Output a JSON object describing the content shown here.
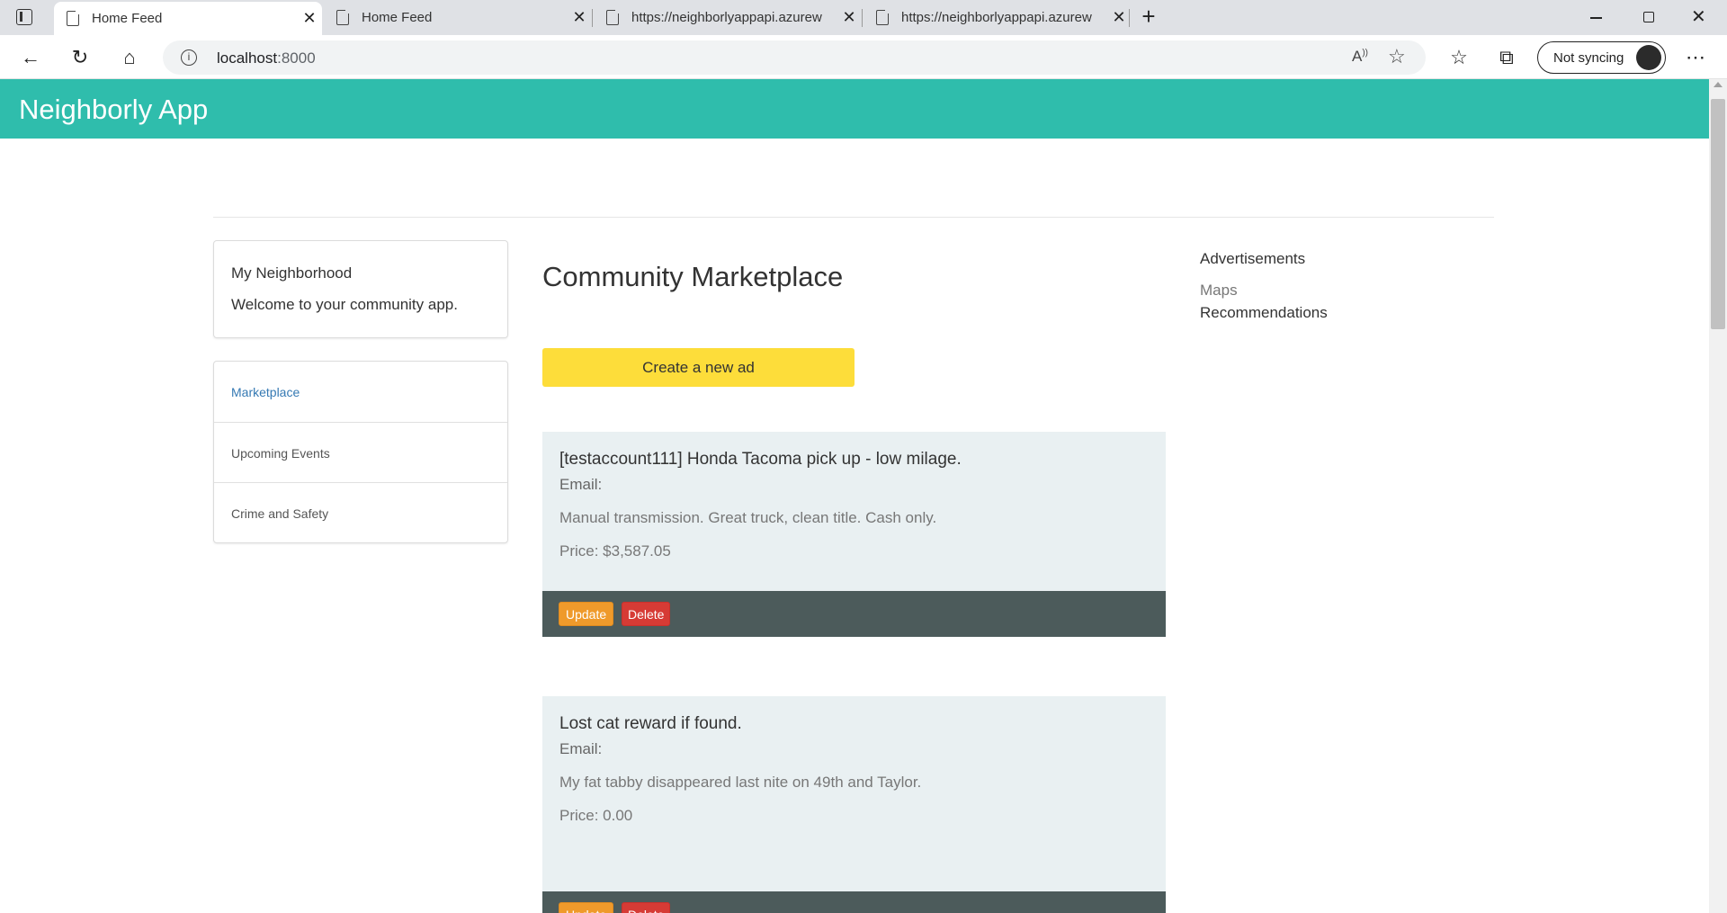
{
  "browser": {
    "tabs": [
      {
        "label": "Home Feed",
        "active": true
      },
      {
        "label": "Home Feed",
        "active": false
      },
      {
        "label": "https://neighborlyappapi.azurew",
        "active": false
      },
      {
        "label": "https://neighborlyappapi.azurew",
        "active": false
      }
    ],
    "address": {
      "host": "localhost",
      "port": ":8000"
    },
    "sync_label": "Not syncing"
  },
  "app": {
    "title": "Neighborly App",
    "sidebar": {
      "panel_title": "My Neighborhood",
      "welcome": "Welcome to your community app.",
      "nav": [
        {
          "label": "Marketplace",
          "active": true
        },
        {
          "label": "Upcoming Events",
          "active": false
        },
        {
          "label": "Crime and Safety",
          "active": false
        }
      ]
    },
    "main": {
      "title": "Community Marketplace",
      "create_label": "Create a new ad",
      "ads": [
        {
          "title": "[testaccount111] Honda Tacoma pick up - low milage.",
          "email": "Email:",
          "description": "Manual transmission. Great truck, clean title. Cash only.",
          "price": "Price: $3,587.05",
          "update_label": "Update",
          "delete_label": "Delete"
        },
        {
          "title": "Lost cat reward if found.",
          "email": "Email:",
          "description": "My fat tabby disappeared last nite on 49th and Taylor.",
          "price": "Price: 0.00",
          "update_label": "Update",
          "delete_label": "Delete"
        }
      ]
    },
    "right": {
      "heading": "Advertisements",
      "maps": "Maps",
      "recommendations": "Recommendations"
    }
  },
  "colors": {
    "appbar": "#2fbdac",
    "create_button": "#fddd3a",
    "update_button": "#ef9a2b",
    "delete_button": "#d63b35",
    "card_bg": "#e9f0f2",
    "card_footer": "#4c5b5b",
    "nav_active": "#3579b3"
  }
}
